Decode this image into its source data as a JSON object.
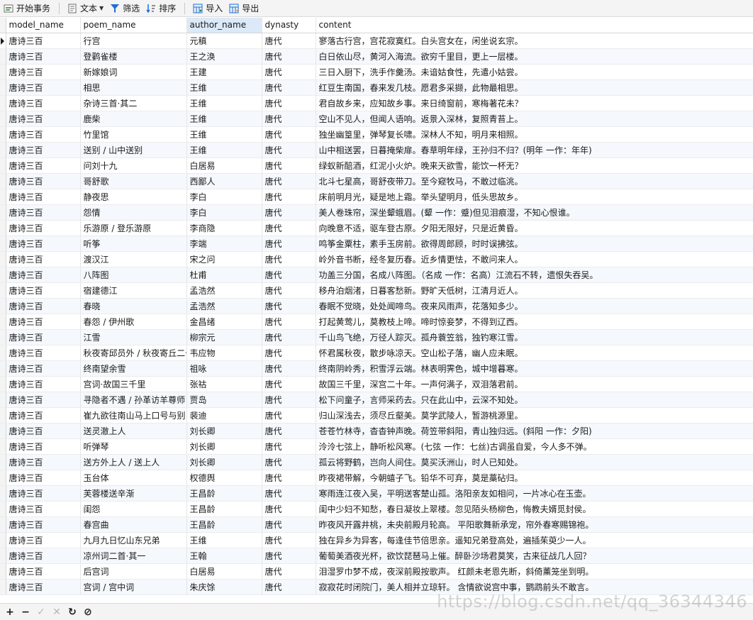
{
  "toolbar": {
    "items": [
      {
        "label": "开始事务",
        "icon": "begin-transaction-icon"
      },
      {
        "label": "文本",
        "icon": "text-icon"
      },
      {
        "label": "筛选",
        "icon": "filter-icon"
      },
      {
        "label": "排序",
        "icon": "sort-icon"
      },
      {
        "label": "导入",
        "icon": "import-icon"
      },
      {
        "label": "导出",
        "icon": "export-icon"
      }
    ],
    "accent": "#1f6fd1"
  },
  "grid": {
    "columns": [
      "model_name",
      "poem_name",
      "author_name",
      "dynasty",
      "content"
    ],
    "sorted_column": "author_name",
    "rows": [
      [
        "唐诗三百",
        "行宫",
        "元稹",
        "唐代",
        "寥落古行宫，宫花寂寞红。白头宫女在，闲坐说玄宗。"
      ],
      [
        "唐诗三百",
        "登鹳雀楼",
        "王之涣",
        "唐代",
        "白日依山尽，黄河入海流。欲穷千里目，更上一层楼。"
      ],
      [
        "唐诗三百",
        "新嫁娘词",
        "王建",
        "唐代",
        "三日入厨下，洗手作羹汤。未谙姑食性，先遣小姑尝。"
      ],
      [
        "唐诗三百",
        "相思",
        "王维",
        "唐代",
        "红豆生南国，春来发几枝。愿君多采撷，此物最相思。"
      ],
      [
        "唐诗三百",
        "杂诗三首·其二",
        "王维",
        "唐代",
        "君自故乡来，应知故乡事。来日绮窗前，寒梅著花未？"
      ],
      [
        "唐诗三百",
        "鹿柴",
        "王维",
        "唐代",
        "空山不见人，但闻人语响。返景入深林，复照青苔上。"
      ],
      [
        "唐诗三百",
        "竹里馆",
        "王维",
        "唐代",
        "独坐幽篁里，弹琴复长啸。深林人不知，明月来相照。"
      ],
      [
        "唐诗三百",
        "送别 / 山中送别",
        "王维",
        "唐代",
        "山中相送罢，日暮掩柴扉。春草明年绿，王孙归不归？(明年 一作：年年)"
      ],
      [
        "唐诗三百",
        "问刘十九",
        "白居易",
        "唐代",
        "绿蚁新醅酒，红泥小火炉。晚来天欲雪，能饮一杯无？"
      ],
      [
        "唐诗三百",
        "哥舒歌",
        "西鄙人",
        "唐代",
        "北斗七星高，哥舒夜带刀。至今窥牧马，不敢过临洮。"
      ],
      [
        "唐诗三百",
        "静夜思",
        "李白",
        "唐代",
        "床前明月光，疑是地上霜。举头望明月，低头思故乡。"
      ],
      [
        "唐诗三百",
        "怨情",
        "李白",
        "唐代",
        "美人卷珠帘，深坐颦蛾眉。(颦 一作：蹙)但见泪痕湿，不知心恨谁。"
      ],
      [
        "唐诗三百",
        "乐游原 / 登乐游原",
        "李商隐",
        "唐代",
        "向晚意不适，驱车登古原。夕阳无限好，只是近黄昏。"
      ],
      [
        "唐诗三百",
        "听筝",
        "李端",
        "唐代",
        "鸣筝金粟柱，素手玉房前。欲得周郎顾，时时误拂弦。"
      ],
      [
        "唐诗三百",
        "渡汉江",
        "宋之问",
        "唐代",
        "岭外音书断，经冬复历春。近乡情更怯，不敢问来人。"
      ],
      [
        "唐诗三百",
        "八阵图",
        "杜甫",
        "唐代",
        "功盖三分国，名成八阵图。（名成 一作：名高）江流石不转，遗恨失吞吴。"
      ],
      [
        "唐诗三百",
        "宿建德江",
        "孟浩然",
        "唐代",
        "移舟泊烟渚，日暮客愁新。野旷天低树，江清月近人。"
      ],
      [
        "唐诗三百",
        "春晓",
        "孟浩然",
        "唐代",
        "春眠不觉晓，处处闻啼鸟。夜来风雨声，花落知多少。"
      ],
      [
        "唐诗三百",
        "春怨 / 伊州歌",
        "金昌绪",
        "唐代",
        "打起黄莺儿，莫教枝上啼。啼时惊妾梦，不得到辽西。"
      ],
      [
        "唐诗三百",
        "江雪",
        "柳宗元",
        "唐代",
        "千山鸟飞绝，万径人踪灭。孤舟蓑笠翁，独钓寒江雪。"
      ],
      [
        "唐诗三百",
        "秋夜寄邱员外 / 秋夜寄丘二十二员外",
        "韦应物",
        "唐代",
        "怀君属秋夜，散步咏凉天。空山松子落，幽人应未眠。"
      ],
      [
        "唐诗三百",
        "终南望余雪",
        "祖咏",
        "唐代",
        "终南阴岭秀，积雪浮云端。林表明霁色，城中增暮寒。"
      ],
      [
        "唐诗三百",
        "宫词·故国三千里",
        "张祜",
        "唐代",
        "故国三千里，深宫二十年。一声何满子，双泪落君前。"
      ],
      [
        "唐诗三百",
        "寻隐者不遇 / 孙革访羊尊师",
        "贾岛",
        "唐代",
        "松下问童子，言师采药去。只在此山中，云深不知处。"
      ],
      [
        "唐诗三百",
        "崔九欲往南山马上口号与别",
        "裴迪",
        "唐代",
        "归山深浅去，须尽丘壑美。莫学武陵人，暂游桃源里。"
      ],
      [
        "唐诗三百",
        "送灵澈上人",
        "刘长卿",
        "唐代",
        "苍苍竹林寺，杳杳钟声晚。荷笠带斜阳，青山独归远。(斜阳 一作：夕阳)"
      ],
      [
        "唐诗三百",
        "听弹琴",
        "刘长卿",
        "唐代",
        "泠泠七弦上，静听松风寒。(七弦 一作：七丝)古调虽自爱，今人多不弹。"
      ],
      [
        "唐诗三百",
        "送方外上人 / 送上人",
        "刘长卿",
        "唐代",
        "孤云将野鹤，岂向人间住。莫买沃洲山，时人已知处。"
      ],
      [
        "唐诗三百",
        "玉台体",
        "权德舆",
        "唐代",
        "昨夜裙带解，今朝蟢子飞。铅华不可弃，莫是藁砧归。"
      ],
      [
        "唐诗三百",
        "芙蓉楼送辛渐",
        "王昌龄",
        "唐代",
        "寒雨连江夜入吴，平明送客楚山孤。洛阳亲友如相问，一片冰心在玉壶。"
      ],
      [
        "唐诗三百",
        "闺怨",
        "王昌龄",
        "唐代",
        "闺中少妇不知愁，春日凝妆上翠楼。忽见陌头杨柳色，悔教夫婿觅封侯。"
      ],
      [
        "唐诗三百",
        "春宫曲",
        "王昌龄",
        "唐代",
        "昨夜风开露井桃，未央前殿月轮高。 平阳歌舞新承宠，帘外春寒赐锦袍。"
      ],
      [
        "唐诗三百",
        "九月九日忆山东兄弟",
        "王维",
        "唐代",
        "独在异乡为异客，每逢佳节倍思亲。遥知兄弟登高处，遍插茱萸少一人。"
      ],
      [
        "唐诗三百",
        "凉州词二首·其一",
        "王翰",
        "唐代",
        "葡萄美酒夜光杯，欲饮琵琶马上催。醉卧沙场君莫笑，古来征战几人回？"
      ],
      [
        "唐诗三百",
        "后宫词",
        "白居易",
        "唐代",
        "泪湿罗巾梦不成，夜深前殿按歌声。 红颜未老恩先断，斜倚薰笼坐到明。"
      ],
      [
        "唐诗三百",
        "宫词 / 宫中词",
        "朱庆馀",
        "唐代",
        "寂寂花时闭院门，美人相并立琼轩。 含情欲说宫中事，鹦鹉前头不敢言。"
      ]
    ]
  },
  "statusbar": {
    "buttons": [
      {
        "label": "+",
        "icon": "add-record-icon",
        "enabled": true
      },
      {
        "label": "−",
        "icon": "delete-record-icon",
        "enabled": true
      },
      {
        "label": "✓",
        "icon": "apply-changes-icon",
        "enabled": false
      },
      {
        "label": "✕",
        "icon": "discard-changes-icon",
        "enabled": false
      },
      {
        "label": "↻",
        "icon": "refresh-icon",
        "enabled": true
      },
      {
        "label": "⊘",
        "icon": "stop-icon",
        "enabled": true
      }
    ],
    "watermark": "https://blog.csdn.net/qq_36344346"
  },
  "colors": {
    "header_sorted_bg": "#dbe9f8",
    "row_alt_bg": "#f5f8fc"
  }
}
